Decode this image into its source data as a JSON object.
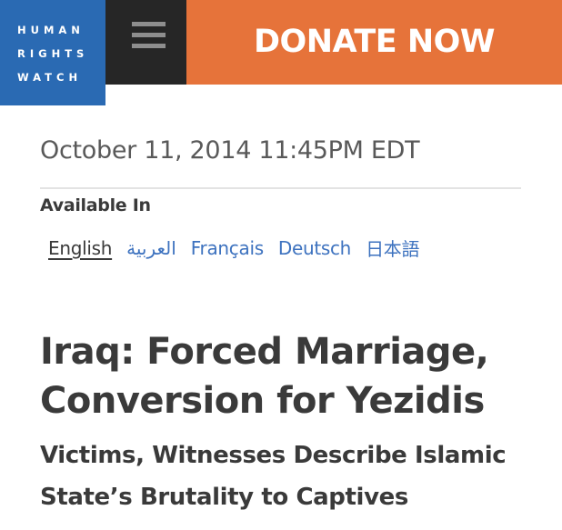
{
  "header": {
    "logo_lines": [
      "HUMAN",
      "RIGHTS",
      "WATCH"
    ],
    "donate_label": "DONATE NOW"
  },
  "article": {
    "date": "October 11, 2014 11:45PM EDT",
    "available_in_label": "Available In",
    "languages": [
      {
        "label": "English",
        "active": true
      },
      {
        "label": "العربية",
        "active": false
      },
      {
        "label": "Français",
        "active": false
      },
      {
        "label": "Deutsch",
        "active": false
      },
      {
        "label": "日本語",
        "active": false
      }
    ],
    "title_lines": [
      "Iraq: Forced Marriage,",
      "Conversion for Yezidis"
    ],
    "subtitle_lines": [
      "Victims, Witnesses Describe Islamic",
      "State’s Brutality to Captives"
    ]
  },
  "colors": {
    "logo_bg": "#2a6ab3",
    "menu_bg": "#262626",
    "donate_bg": "#e6733a",
    "link": "#3d72bf",
    "text": "#3a3a3a"
  },
  "icons": {
    "menu": "hamburger-menu-icon"
  }
}
